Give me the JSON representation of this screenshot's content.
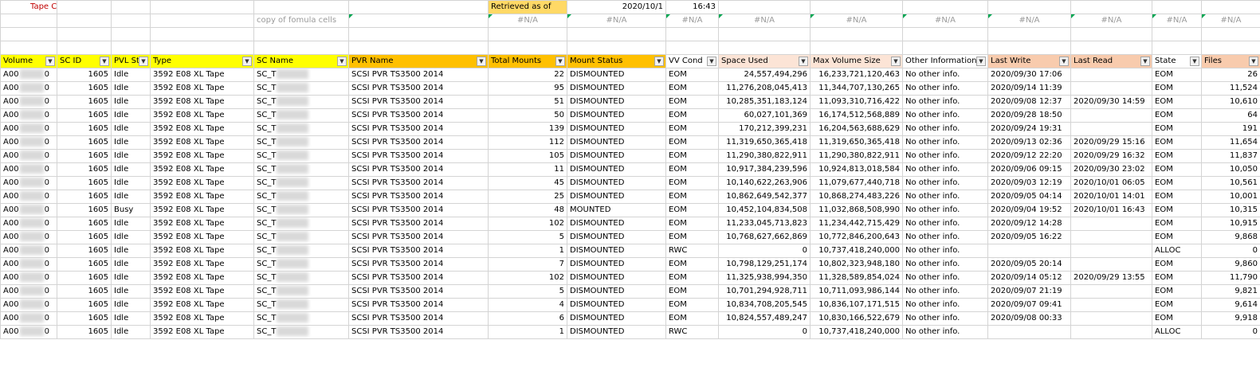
{
  "sheet": {
    "title": "Tape Catalog",
    "retrieved_label": "Retrieved as of",
    "retrieved_date": "2020/10/1",
    "retrieved_time": "16:43",
    "copy_note": "copy of fomula cells",
    "na": "#N/A"
  },
  "columns": [
    {
      "key": "volume",
      "label": "Volume",
      "color": "#ffff00"
    },
    {
      "key": "sc_id",
      "label": "SC ID",
      "color": "#ffff00"
    },
    {
      "key": "pvl",
      "label": "PVL St",
      "color": "#ffff00"
    },
    {
      "key": "type",
      "label": "Type",
      "color": "#ffff00"
    },
    {
      "key": "sc_name",
      "label": "SC Name",
      "color": "#ffff00"
    },
    {
      "key": "pvr",
      "label": "PVR Name",
      "color": "#ffc000"
    },
    {
      "key": "mounts",
      "label": "Total Mounts",
      "color": "#ffc000"
    },
    {
      "key": "mount_status",
      "label": "Mount Status",
      "color": "#ffc000"
    },
    {
      "key": "vv",
      "label": "VV Cond",
      "color": "#ffffff"
    },
    {
      "key": "space",
      "label": "Space Used",
      "color": "#fce4d6"
    },
    {
      "key": "max",
      "label": "Max Volume Size",
      "color": "#fce4d6"
    },
    {
      "key": "other",
      "label": "Other Information",
      "color": "#ffffff"
    },
    {
      "key": "last_write",
      "label": "Last Write",
      "color": "#f8cbad"
    },
    {
      "key": "last_read",
      "label": "Last Read",
      "color": "#f8cbad"
    },
    {
      "key": "state",
      "label": "State",
      "color": "#ffffff"
    },
    {
      "key": "files",
      "label": "Files",
      "color": "#f8cbad"
    }
  ],
  "rows": [
    {
      "volume": "A00",
      "vol_end": "0",
      "sc_id": "1605",
      "pvl": "Idle",
      "type": "3592 E08 XL Tape",
      "sc_name": "SC_T",
      "pvr": "SCSI PVR TS3500 2014",
      "mounts": "22",
      "mount_status": "DISMOUNTED",
      "vv": "EOM",
      "space": "24,557,494,296",
      "max": "16,233,721,120,463",
      "other": "No other info.",
      "last_write": "2020/09/30 17:06",
      "last_read": "",
      "state": "EOM",
      "files": "26"
    },
    {
      "volume": "A00",
      "vol_end": "0",
      "sc_id": "1605",
      "pvl": "Idle",
      "type": "3592 E08 XL Tape",
      "sc_name": "SC_T",
      "pvr": "SCSI PVR TS3500 2014",
      "mounts": "95",
      "mount_status": "DISMOUNTED",
      "vv": "EOM",
      "space": "11,276,208,045,413",
      "max": "11,344,707,130,265",
      "other": "No other info.",
      "last_write": "2020/09/14 11:39",
      "last_read": "",
      "state": "EOM",
      "files": "11,524"
    },
    {
      "volume": "A00",
      "vol_end": "0",
      "sc_id": "1605",
      "pvl": "Idle",
      "type": "3592 E08 XL Tape",
      "sc_name": "SC_T",
      "pvr": "SCSI PVR TS3500 2014",
      "mounts": "51",
      "mount_status": "DISMOUNTED",
      "vv": "EOM",
      "space": "10,285,351,183,124",
      "max": "11,093,310,716,422",
      "other": "No other info.",
      "last_write": "2020/09/08 12:37",
      "last_read": "2020/09/30 14:59",
      "state": "EOM",
      "files": "10,610"
    },
    {
      "volume": "A00",
      "vol_end": "0",
      "sc_id": "1605",
      "pvl": "Idle",
      "type": "3592 E08 XL Tape",
      "sc_name": "SC_T",
      "pvr": "SCSI PVR TS3500 2014",
      "mounts": "50",
      "mount_status": "DISMOUNTED",
      "vv": "EOM",
      "space": "60,027,101,369",
      "max": "16,174,512,568,889",
      "other": "No other info.",
      "last_write": "2020/09/28 18:50",
      "last_read": "",
      "state": "EOM",
      "files": "64"
    },
    {
      "volume": "A00",
      "vol_end": "0",
      "sc_id": "1605",
      "pvl": "Idle",
      "type": "3592 E08 XL Tape",
      "sc_name": "SC_T",
      "pvr": "SCSI PVR TS3500 2014",
      "mounts": "139",
      "mount_status": "DISMOUNTED",
      "vv": "EOM",
      "space": "170,212,399,231",
      "max": "16,204,563,688,629",
      "other": "No other info.",
      "last_write": "2020/09/24 19:31",
      "last_read": "",
      "state": "EOM",
      "files": "191"
    },
    {
      "volume": "A00",
      "vol_end": "0",
      "sc_id": "1605",
      "pvl": "Idle",
      "type": "3592 E08 XL Tape",
      "sc_name": "SC_T",
      "pvr": "SCSI PVR TS3500 2014",
      "mounts": "112",
      "mount_status": "DISMOUNTED",
      "vv": "EOM",
      "space": "11,319,650,365,418",
      "max": "11,319,650,365,418",
      "other": "No other info.",
      "last_write": "2020/09/13 02:36",
      "last_read": "2020/09/29 15:16",
      "state": "EOM",
      "files": "11,654"
    },
    {
      "volume": "A00",
      "vol_end": "0",
      "sc_id": "1605",
      "pvl": "Idle",
      "type": "3592 E08 XL Tape",
      "sc_name": "SC_T",
      "pvr": "SCSI PVR TS3500 2014",
      "mounts": "105",
      "mount_status": "DISMOUNTED",
      "vv": "EOM",
      "space": "11,290,380,822,911",
      "max": "11,290,380,822,911",
      "other": "No other info.",
      "last_write": "2020/09/12 22:20",
      "last_read": "2020/09/29 16:32",
      "state": "EOM",
      "files": "11,837"
    },
    {
      "volume": "A00",
      "vol_end": "0",
      "sc_id": "1605",
      "pvl": "Idle",
      "type": "3592 E08 XL Tape",
      "sc_name": "SC_T",
      "pvr": "SCSI PVR TS3500 2014",
      "mounts": "11",
      "mount_status": "DISMOUNTED",
      "vv": "EOM",
      "space": "10,917,384,239,596",
      "max": "10,924,813,018,584",
      "other": "No other info.",
      "last_write": "2020/09/06 09:15",
      "last_read": "2020/09/30 23:02",
      "state": "EOM",
      "files": "10,050"
    },
    {
      "volume": "A00",
      "vol_end": "0",
      "sc_id": "1605",
      "pvl": "Idle",
      "type": "3592 E08 XL Tape",
      "sc_name": "SC_T",
      "pvr": "SCSI PVR TS3500 2014",
      "mounts": "45",
      "mount_status": "DISMOUNTED",
      "vv": "EOM",
      "space": "10,140,622,263,906",
      "max": "11,079,677,440,718",
      "other": "No other info.",
      "last_write": "2020/09/03 12:19",
      "last_read": "2020/10/01 06:05",
      "state": "EOM",
      "files": "10,561"
    },
    {
      "volume": "A00",
      "vol_end": "0",
      "sc_id": "1605",
      "pvl": "Idle",
      "type": "3592 E08 XL Tape",
      "sc_name": "SC_T",
      "pvr": "SCSI PVR TS3500 2014",
      "mounts": "25",
      "mount_status": "DISMOUNTED",
      "vv": "EOM",
      "space": "10,862,649,542,377",
      "max": "10,868,274,483,226",
      "other": "No other info.",
      "last_write": "2020/09/05 04:14",
      "last_read": "2020/10/01 14:01",
      "state": "EOM",
      "files": "10,001"
    },
    {
      "volume": "A00",
      "vol_end": "0",
      "sc_id": "1605",
      "pvl": "Busy",
      "type": "3592 E08 XL Tape",
      "sc_name": "SC_T",
      "pvr": "SCSI PVR TS3500 2014",
      "mounts": "48",
      "mount_status": "MOUNTED",
      "vv": "EOM",
      "space": "10,452,104,834,508",
      "max": "11,032,868,508,990",
      "other": "No other info.",
      "last_write": "2020/09/04 19:52",
      "last_read": "2020/10/01 16:43",
      "state": "EOM",
      "files": "10,315"
    },
    {
      "volume": "A00",
      "vol_end": "0",
      "sc_id": "1605",
      "pvl": "Idle",
      "type": "3592 E08 XL Tape",
      "sc_name": "SC_T",
      "pvr": "SCSI PVR TS3500 2014",
      "mounts": "102",
      "mount_status": "DISMOUNTED",
      "vv": "EOM",
      "space": "11,233,045,713,823",
      "max": "11,234,442,715,429",
      "other": "No other info.",
      "last_write": "2020/09/12 14:28",
      "last_read": "",
      "state": "EOM",
      "files": "10,915"
    },
    {
      "volume": "A00",
      "vol_end": "0",
      "sc_id": "1605",
      "pvl": "Idle",
      "type": "3592 E08 XL Tape",
      "sc_name": "SC_T",
      "pvr": "SCSI PVR TS3500 2014",
      "mounts": "5",
      "mount_status": "DISMOUNTED",
      "vv": "EOM",
      "space": "10,768,627,662,869",
      "max": "10,772,846,200,643",
      "other": "No other info.",
      "last_write": "2020/09/05 16:22",
      "last_read": "",
      "state": "EOM",
      "files": "9,868"
    },
    {
      "volume": "A00",
      "vol_end": "0",
      "sc_id": "1605",
      "pvl": "Idle",
      "type": "3592 E08 XL Tape",
      "sc_name": "SC_T",
      "pvr": "SCSI PVR TS3500 2014",
      "mounts": "1",
      "mount_status": "DISMOUNTED",
      "vv": "RWC",
      "space": "0",
      "max": "10,737,418,240,000",
      "other": "No other info.",
      "last_write": "",
      "last_read": "",
      "state": "ALLOC",
      "files": "0"
    },
    {
      "volume": "A00",
      "vol_end": "0",
      "sc_id": "1605",
      "pvl": "Idle",
      "type": "3592 E08 XL Tape",
      "sc_name": "SC_T",
      "pvr": "SCSI PVR TS3500 2014",
      "mounts": "7",
      "mount_status": "DISMOUNTED",
      "vv": "EOM",
      "space": "10,798,129,251,174",
      "max": "10,802,323,948,180",
      "other": "No other info.",
      "last_write": "2020/09/05 20:14",
      "last_read": "",
      "state": "EOM",
      "files": "9,860"
    },
    {
      "volume": "A00",
      "vol_end": "0",
      "sc_id": "1605",
      "pvl": "Idle",
      "type": "3592 E08 XL Tape",
      "sc_name": "SC_T",
      "pvr": "SCSI PVR TS3500 2014",
      "mounts": "102",
      "mount_status": "DISMOUNTED",
      "vv": "EOM",
      "space": "11,325,938,994,350",
      "max": "11,328,589,854,024",
      "other": "No other info.",
      "last_write": "2020/09/14 05:12",
      "last_read": "2020/09/29 13:55",
      "state": "EOM",
      "files": "11,790"
    },
    {
      "volume": "A00",
      "vol_end": "0",
      "sc_id": "1605",
      "pvl": "Idle",
      "type": "3592 E08 XL Tape",
      "sc_name": "SC_T",
      "pvr": "SCSI PVR TS3500 2014",
      "mounts": "5",
      "mount_status": "DISMOUNTED",
      "vv": "EOM",
      "space": "10,701,294,928,711",
      "max": "10,711,093,986,144",
      "other": "No other info.",
      "last_write": "2020/09/07 21:19",
      "last_read": "",
      "state": "EOM",
      "files": "9,821"
    },
    {
      "volume": "A00",
      "vol_end": "0",
      "sc_id": "1605",
      "pvl": "Idle",
      "type": "3592 E08 XL Tape",
      "sc_name": "SC_T",
      "pvr": "SCSI PVR TS3500 2014",
      "mounts": "4",
      "mount_status": "DISMOUNTED",
      "vv": "EOM",
      "space": "10,834,708,205,545",
      "max": "10,836,107,171,515",
      "other": "No other info.",
      "last_write": "2020/09/07 09:41",
      "last_read": "",
      "state": "EOM",
      "files": "9,614"
    },
    {
      "volume": "A00",
      "vol_end": "0",
      "sc_id": "1605",
      "pvl": "Idle",
      "type": "3592 E08 XL Tape",
      "sc_name": "SC_T",
      "pvr": "SCSI PVR TS3500 2014",
      "mounts": "6",
      "mount_status": "DISMOUNTED",
      "vv": "EOM",
      "space": "10,824,557,489,247",
      "max": "10,830,166,522,679",
      "other": "No other info.",
      "last_write": "2020/09/08 00:33",
      "last_read": "",
      "state": "EOM",
      "files": "9,918"
    },
    {
      "volume": "A00",
      "vol_end": "0",
      "sc_id": "1605",
      "pvl": "Idle",
      "type": "3592 E08 XL Tape",
      "sc_name": "SC_T",
      "pvr": "SCSI PVR TS3500 2014",
      "mounts": "1",
      "mount_status": "DISMOUNTED",
      "vv": "RWC",
      "space": "0",
      "max": "10,737,418,240,000",
      "other": "No other info.",
      "last_write": "",
      "last_read": "",
      "state": "ALLOC",
      "files": "0"
    }
  ],
  "icons": {
    "filter": "dropdown-filter-icon"
  }
}
